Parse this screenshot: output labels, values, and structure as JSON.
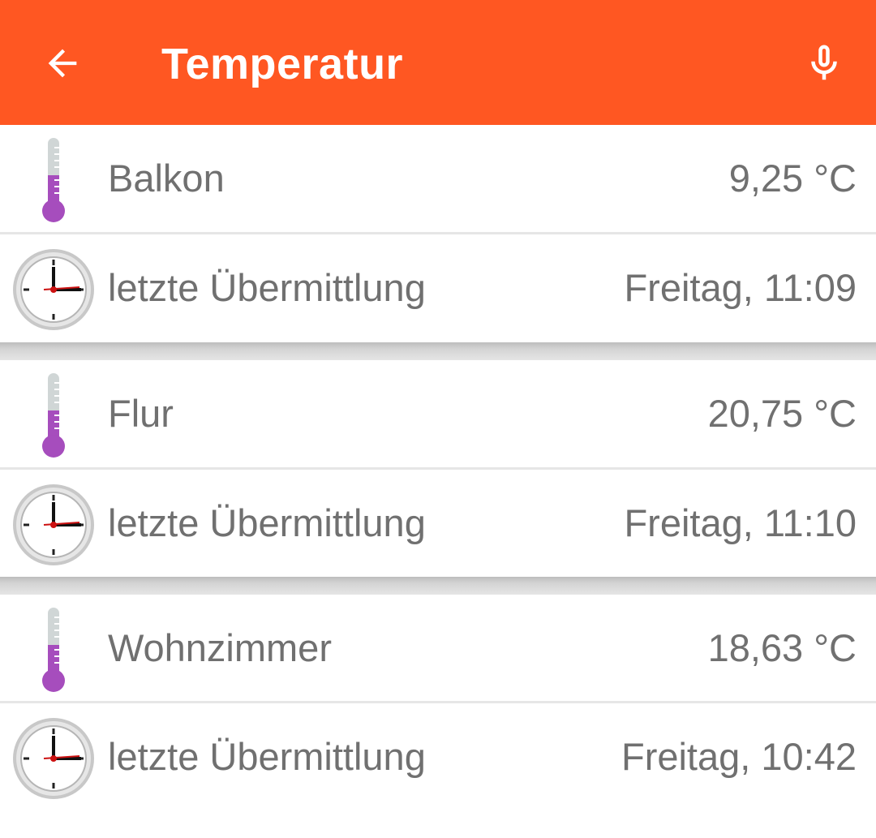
{
  "appbar": {
    "title": "Temperatur",
    "back_icon": "arrow-back-icon",
    "mic_icon": "microphone-icon",
    "color": "#ff5722"
  },
  "groups": [
    {
      "sensor": {
        "name": "Balkon",
        "value": "9,25 °C",
        "icon": "thermometer-icon"
      },
      "update": {
        "label": "letzte Übermittlung",
        "value": "Freitag, 11:09",
        "icon": "clock-icon"
      }
    },
    {
      "sensor": {
        "name": "Flur",
        "value": "20,75 °C",
        "icon": "thermometer-icon"
      },
      "update": {
        "label": "letzte Übermittlung",
        "value": "Freitag, 11:10",
        "icon": "clock-icon"
      }
    },
    {
      "sensor": {
        "name": "Wohnzimmer",
        "value": "18,63 °C",
        "icon": "thermometer-icon"
      },
      "update": {
        "label": "letzte Übermittlung",
        "value": "Freitag, 10:42",
        "icon": "clock-icon"
      }
    }
  ],
  "colors": {
    "text": "#707070",
    "thermometer_fill": "#a64dbd",
    "thermometer_tube": "#d0d6d6"
  }
}
